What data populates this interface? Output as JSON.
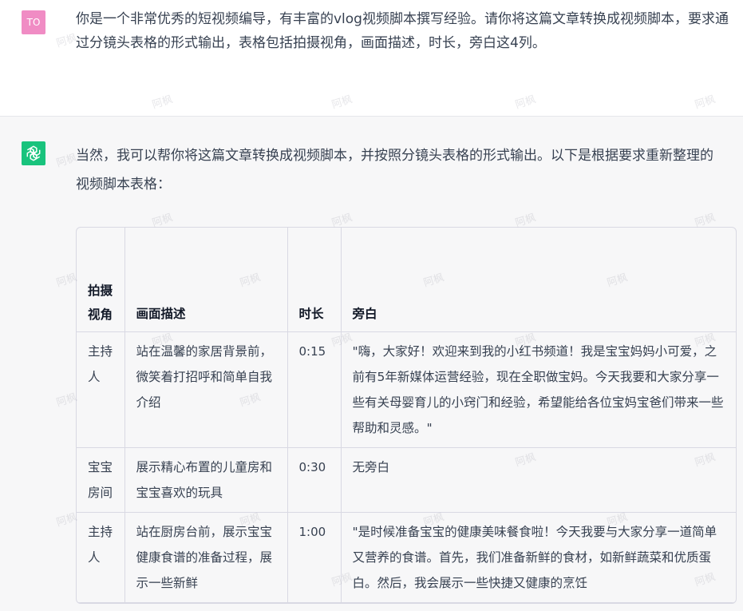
{
  "user_message": {
    "avatar_initials": "TO",
    "text": "你是一个非常优秀的短视频编导，有丰富的vlog视频脚本撰写经验。请你将这篇文章转换成视频脚本，要求通过分镜头表格的形式输出，表格包括拍摄视角，画面描述，时长，旁白这4列。"
  },
  "assistant_message": {
    "avatar_icon": "openai-logo-icon",
    "intro": "当然，我可以帮你将这篇文章转换成视频脚本，并按照分镜头表格的形式输出。以下是根据要求重新整理的视频脚本表格：",
    "table": {
      "headers": [
        "拍摄视角",
        "画面描述",
        "时长",
        "旁白"
      ],
      "rows": [
        {
          "angle": "主持人",
          "description": "站在温馨的家居背景前，微笑着打招呼和简单自我介绍",
          "duration": "0:15",
          "narration": "\"嗨，大家好！欢迎来到我的小红书频道！我是宝宝妈妈小可爱，之前有5年新媒体运营经验，现在全职做宝妈。今天我要和大家分享一些有关母婴育儿的小窍门和经验，希望能给各位宝妈宝爸们带来一些帮助和灵感。\""
        },
        {
          "angle": "宝宝房间",
          "description": "展示精心布置的儿童房和宝宝喜欢的玩具",
          "duration": "0:30",
          "narration": "无旁白"
        },
        {
          "angle": "主持人",
          "description": "站在厨房台前，展示宝宝健康食谱的准备过程，展示一些新鲜",
          "duration": "1:00",
          "narration": "\"是时候准备宝宝的健康美味餐食啦！今天我要与大家分享一道简单又营养的食谱。首先，我们准备新鲜的食材，如新鲜蔬菜和优质蛋白。然后，我会展示一些快捷又健康的烹饪"
        }
      ]
    }
  },
  "watermark_text": "阿枫",
  "colors": {
    "user_avatar": "#f08cc4",
    "assistant_avatar": "#19c37d",
    "assistant_bg": "#f7f7f8",
    "text": "#374151"
  }
}
